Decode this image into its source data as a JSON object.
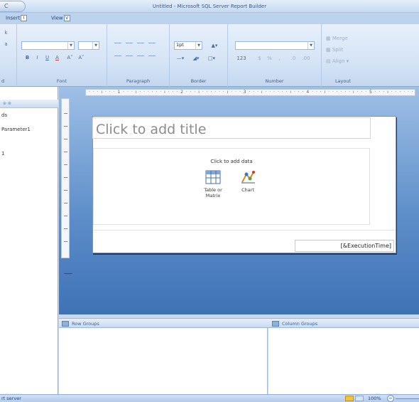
{
  "window": {
    "title": "Untitled - Microsoft SQL Server Report Builder",
    "orb_glyph": "C"
  },
  "tabs": [
    {
      "label": "Insert",
      "key": "I"
    },
    {
      "label": "View",
      "key": "V"
    }
  ],
  "ribbon": {
    "groups": {
      "clipboard_fragment": "d",
      "font": "Font",
      "paragraph": "Paragraph",
      "border": "Border",
      "number": "Number",
      "layout": "Layout"
    },
    "font_buttons": [
      "B",
      "I",
      "U",
      "A",
      "A˄",
      "A˅"
    ],
    "border_width": "1pt",
    "number_buttons": [
      "123",
      "$",
      "%",
      ","
    ],
    "layout_buttons": [
      "Merge",
      "Split",
      "Align"
    ],
    "clipboard_glyphs": [
      "k",
      "a"
    ]
  },
  "left_pane": {
    "header": "⊕ ⊗",
    "items": [
      "ds",
      "Parameter1",
      "1"
    ]
  },
  "ruler": {
    "labels": [
      "1",
      "2",
      "3",
      "4",
      "5"
    ]
  },
  "report": {
    "title_placeholder": "Click to add title",
    "data_prompt": "Click to add data",
    "table_button": "Table or Matrix",
    "chart_button": "Chart",
    "execution_time": "[&ExecutionTime]"
  },
  "groups": {
    "row": "Row Groups",
    "column": "Column Groups"
  },
  "status": {
    "text": "rt server",
    "zoom": "100%",
    "zoom_out": "−"
  },
  "colors": {
    "ribbon": "#d2e2f5",
    "design_surface": "#5f8fca",
    "text": "#15428b"
  }
}
